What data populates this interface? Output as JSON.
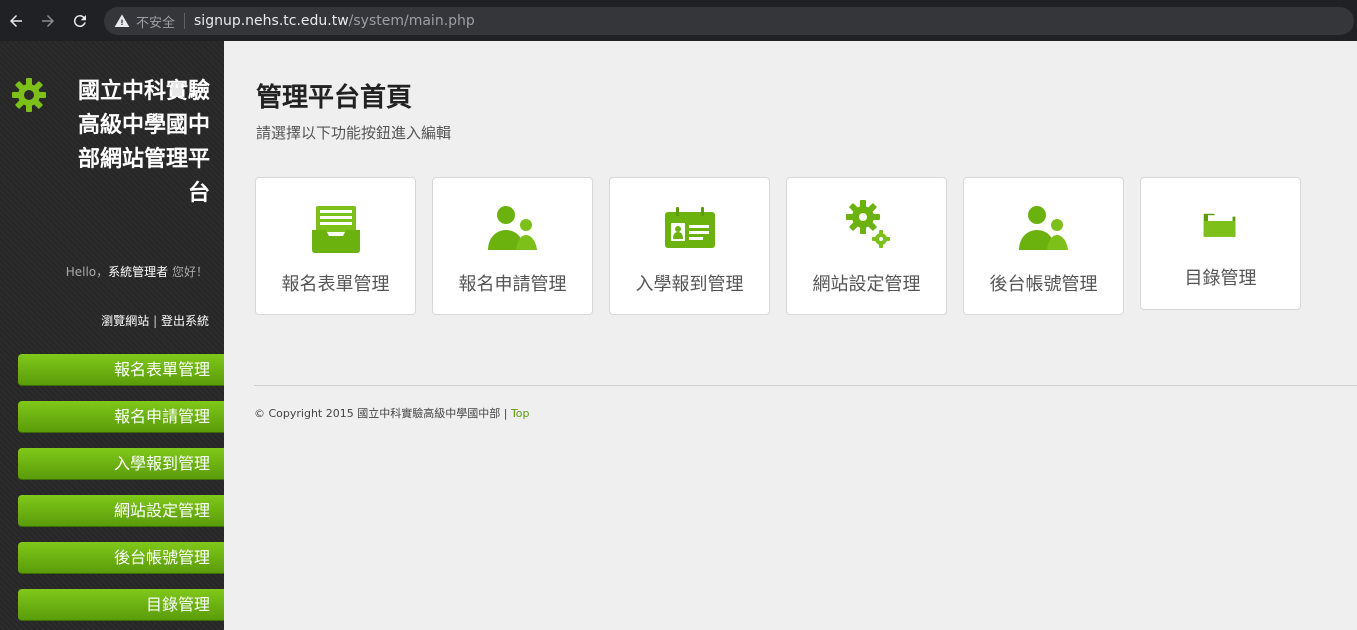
{
  "browser": {
    "insecure_label": "不安全",
    "url_host": "signup.nehs.tc.edu.tw",
    "url_path": "/system/main.php"
  },
  "sidebar": {
    "title": "國立中科實驗高級中學國中部網站管理平台",
    "greeting_hello": "Hello，",
    "greeting_user": "系統管理者",
    "greeting_suffix": " 您好！",
    "link_browse": "瀏覽網站",
    "link_sep": " | ",
    "link_logout": "登出系統",
    "menu": [
      {
        "label": "報名表單管理"
      },
      {
        "label": "報名申請管理"
      },
      {
        "label": "入學報到管理"
      },
      {
        "label": "網站設定管理"
      },
      {
        "label": "後台帳號管理"
      },
      {
        "label": "目錄管理"
      }
    ]
  },
  "main": {
    "title": "管理平台首頁",
    "subtitle": "請選擇以下功能按鈕進入編輯",
    "cards": [
      {
        "label": "報名表單管理",
        "icon": "inbox-icon"
      },
      {
        "label": "報名申請管理",
        "icon": "users-icon"
      },
      {
        "label": "入學報到管理",
        "icon": "id-card-icon"
      },
      {
        "label": "網站設定管理",
        "icon": "gears-icon"
      },
      {
        "label": "後台帳號管理",
        "icon": "users-icon"
      },
      {
        "label": "目錄管理",
        "icon": "folder-icon"
      }
    ]
  },
  "footer": {
    "copyright": "© Copyright 2015 國立中科實驗高級中學國中部 | ",
    "top_link": "Top"
  },
  "colors": {
    "accent": "#6cb20f",
    "sidebar_bg": "#2a2a2a",
    "main_bg": "#efefef"
  }
}
